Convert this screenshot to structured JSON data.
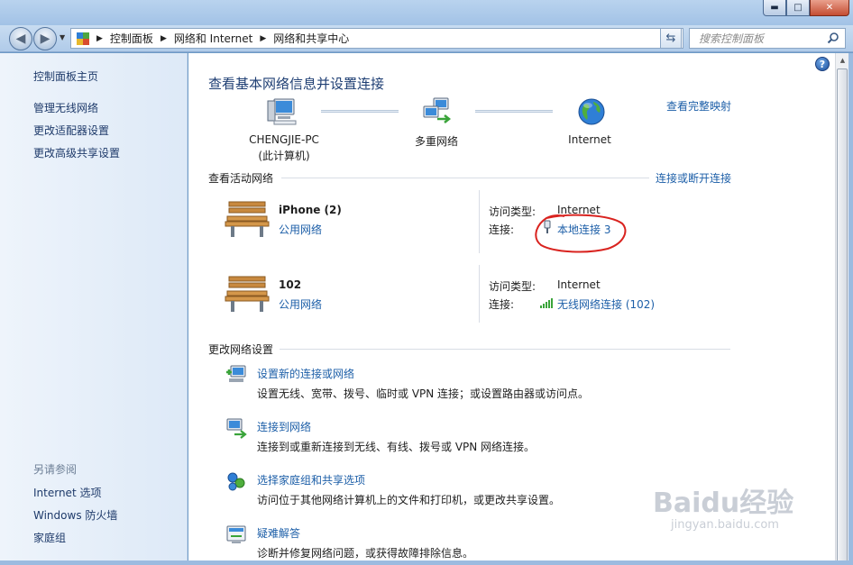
{
  "window": {
    "minimize_label": "▬",
    "maximize_label": "□",
    "close_label": "✕"
  },
  "navigation": {
    "breadcrumbs": [
      "控制面板",
      "网络和 Internet",
      "网络和共享中心"
    ],
    "search_placeholder": "搜索控制面板"
  },
  "sidebar": {
    "items": [
      {
        "label": "控制面板主页"
      },
      {
        "label": "管理无线网络"
      },
      {
        "label": "更改适配器设置"
      },
      {
        "label": "更改高级共享设置"
      }
    ],
    "see_also_title": "另请参阅",
    "see_also": [
      {
        "label": "Internet 选项"
      },
      {
        "label": "Windows 防火墙"
      },
      {
        "label": "家庭组"
      }
    ]
  },
  "main": {
    "title": "查看基本网络信息并设置连接",
    "view_full_map": "查看完整映射",
    "map": {
      "computer_name": "CHENGJIE-PC",
      "computer_sub": "(此计算机)",
      "middle": "多重网络",
      "internet": "Internet"
    },
    "active_networks_title": "查看活动网络",
    "connect_disconnect": "连接或断开连接",
    "networks": [
      {
        "name": "iPhone  (2)",
        "type": "公用网络",
        "access_label": "访问类型:",
        "access_value": "Internet",
        "conn_label": "连接:",
        "conn_value": "本地连接 3"
      },
      {
        "name": "102",
        "type": "公用网络",
        "access_label": "访问类型:",
        "access_value": "Internet",
        "conn_label": "连接:",
        "conn_value": "无线网络连接 (102)"
      }
    ],
    "change_settings_title": "更改网络设置",
    "tasks": [
      {
        "icon": "setup-connection-icon",
        "title": "设置新的连接或网络",
        "desc": "设置无线、宽带、拨号、临时或 VPN 连接；或设置路由器或访问点。"
      },
      {
        "icon": "connect-network-icon",
        "title": "连接到网络",
        "desc": "连接到或重新连接到无线、有线、拨号或 VPN 网络连接。"
      },
      {
        "icon": "homegroup-icon",
        "title": "选择家庭组和共享选项",
        "desc": "访问位于其他网络计算机上的文件和打印机，或更改共享设置。"
      },
      {
        "icon": "troubleshoot-icon",
        "title": "疑难解答",
        "desc": "诊断并修复网络问题，或获得故障排除信息。"
      }
    ]
  },
  "watermark": {
    "text": "Baidu经验",
    "url": "jingyan.baidu.com"
  },
  "colors": {
    "link": "#1d5fa8",
    "title": "#1e3e73",
    "annotation": "#d9231f"
  }
}
